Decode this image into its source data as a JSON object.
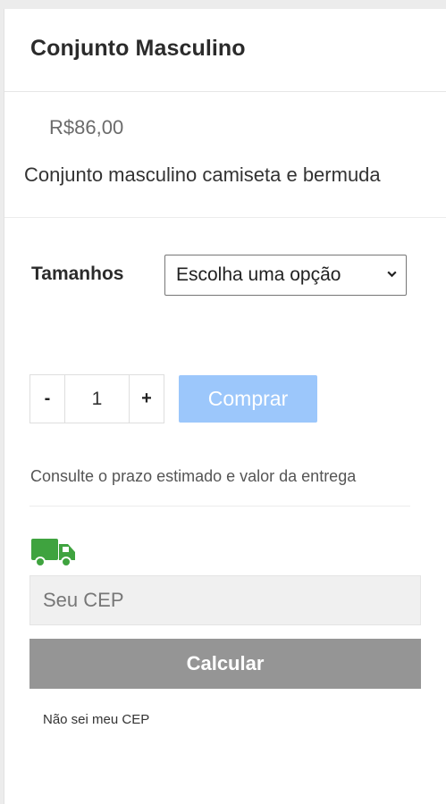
{
  "product": {
    "title": "Conjunto Masculino",
    "price": "R$86,00",
    "description": "Conjunto masculino camiseta e bermuda"
  },
  "options": {
    "size_label": "Tamanhos",
    "size_select_value": "Escolha uma opção",
    "size_select_icon": "chevron-down-icon"
  },
  "purchase": {
    "minus_label": "-",
    "quantity": "1",
    "plus_label": "+",
    "buy_label": "Comprar",
    "buy_color": "#9cc7fb"
  },
  "shipping": {
    "info_text": "Consulte o prazo estimado e valor da entrega",
    "icon": "truck-icon",
    "icon_color": "#3fa33f",
    "cep_placeholder": "Seu CEP",
    "calculate_label": "Calcular",
    "calculate_color": "#959595",
    "unknown_cep_link": "Não sei meu CEP"
  }
}
